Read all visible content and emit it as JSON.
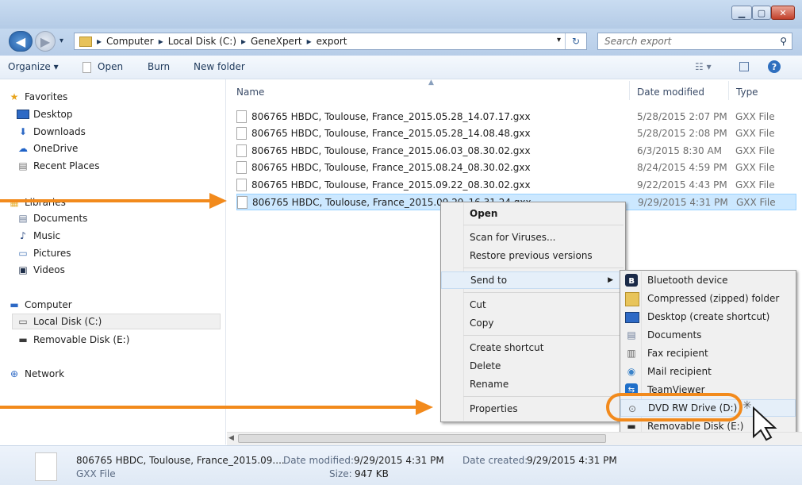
{
  "address": {
    "breadcrumbs": [
      "Computer",
      "Local Disk (C:)",
      "GeneXpert",
      "export"
    ]
  },
  "search": {
    "placeholder": "Search export"
  },
  "toolbar": {
    "organize_label": "Organize ▾",
    "open_label": "Open",
    "burn_label": "Burn",
    "new_folder_label": "New folder"
  },
  "nav": {
    "favorites_label": "Favorites",
    "favorites": [
      "Desktop",
      "Downloads",
      "OneDrive",
      "Recent Places"
    ],
    "libraries_label": "Libraries",
    "libraries": [
      "Documents",
      "Music",
      "Pictures",
      "Videos"
    ],
    "computer_label": "Computer",
    "computer": [
      "Local Disk (C:)",
      "Removable Disk (E:)"
    ],
    "network_label": "Network"
  },
  "columns": {
    "name": "Name",
    "date": "Date modified",
    "type": "Type"
  },
  "files": [
    {
      "name": "806765 HBDC, Toulouse, France_2015.05.28_14.07.17.gxx",
      "date": "5/28/2015 2:07 PM",
      "type": "GXX File"
    },
    {
      "name": "806765 HBDC, Toulouse, France_2015.05.28_14.08.48.gxx",
      "date": "5/28/2015 2:08 PM",
      "type": "GXX File"
    },
    {
      "name": "806765 HBDC, Toulouse, France_2015.06.03_08.30.02.gxx",
      "date": "6/3/2015 8:30 AM",
      "type": "GXX File"
    },
    {
      "name": "806765 HBDC, Toulouse, France_2015.08.24_08.30.02.gxx",
      "date": "8/24/2015 4:59 PM",
      "type": "GXX File"
    },
    {
      "name": "806765 HBDC, Toulouse, France_2015.09.22_08.30.02.gxx",
      "date": "9/22/2015 4:43 PM",
      "type": "GXX File"
    },
    {
      "name": "806765 HBDC, Toulouse, France_2015.09.29_16.31.24.gxx",
      "date": "9/29/2015 4:31 PM",
      "type": "GXX File"
    }
  ],
  "context_menu": {
    "open": "Open",
    "scan": "Scan for Viruses...",
    "restore": "Restore previous versions",
    "send_to": "Send to",
    "cut": "Cut",
    "copy": "Copy",
    "create_shortcut": "Create shortcut",
    "delete": "Delete",
    "rename": "Rename",
    "properties": "Properties"
  },
  "send_to_menu": [
    {
      "label": "Bluetooth device",
      "icon": "bluetooth-icon"
    },
    {
      "label": "Compressed (zipped) folder",
      "icon": "zip-folder-icon"
    },
    {
      "label": "Desktop (create shortcut)",
      "icon": "desktop-icon"
    },
    {
      "label": "Documents",
      "icon": "documents-icon"
    },
    {
      "label": "Fax recipient",
      "icon": "fax-icon"
    },
    {
      "label": "Mail recipient",
      "icon": "mail-icon"
    },
    {
      "label": "TeamViewer",
      "icon": "teamviewer-icon"
    },
    {
      "label": "DVD RW Drive (D:)",
      "icon": "dvd-drive-icon"
    },
    {
      "label": "Removable Disk (E:)",
      "icon": "removable-disk-icon"
    }
  ],
  "details": {
    "name": "806765 HBDC, Toulouse, France_2015.09....",
    "type": "GXX File",
    "date_modified_label": "Date modified:",
    "date_modified": "9/29/2015 4:31 PM",
    "date_created_label": "Date created:",
    "date_created": "9/29/2015 4:31 PM",
    "size_label": "Size:",
    "size": "947 KB"
  },
  "colors": {
    "annotation": "#f28a1c",
    "selection": "#cce8ff"
  }
}
